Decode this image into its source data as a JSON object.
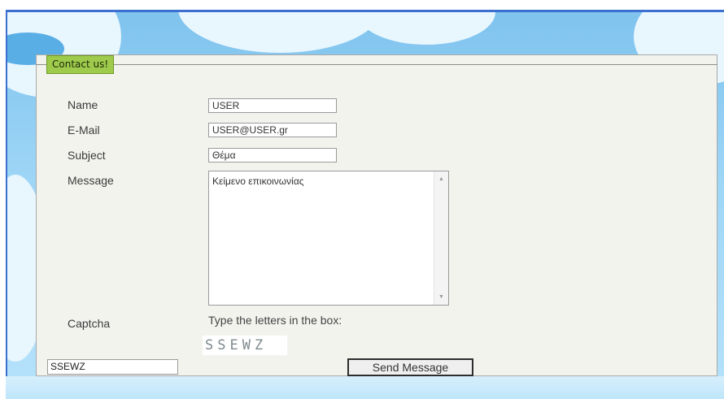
{
  "form": {
    "legend": "Contact us!",
    "labels": {
      "name": "Name",
      "email": "E-Mail",
      "subject": "Subject",
      "message": "Message",
      "captcha": "Captcha"
    },
    "values": {
      "name": "USER",
      "email": "USER@USER.gr",
      "subject": "Θέμα",
      "message": "Κείμενο επικοινωνίας",
      "captcha_input": "SSEWZ"
    },
    "captcha_hint": "Type the letters in the box:",
    "captcha_image_text": "SSEWZ",
    "send_label": "Send Message"
  },
  "colors": {
    "legend_bg": "#9ecb4c",
    "panel_bg": "#f3f3ee",
    "sky": "#7fc3ee"
  },
  "icons": {
    "scroll_up": "scroll-up-icon",
    "scroll_down": "scroll-down-icon"
  }
}
